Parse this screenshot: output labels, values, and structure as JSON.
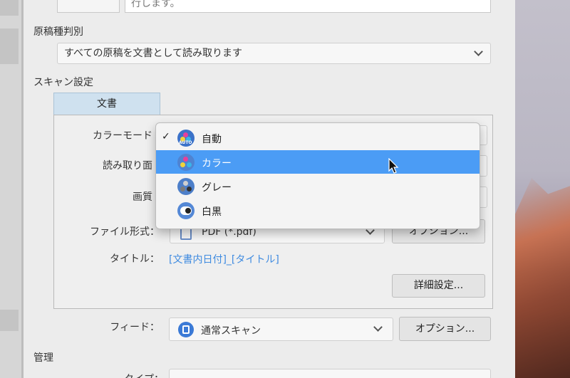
{
  "top": {
    "field_text": "行します。"
  },
  "manuscript": {
    "label": "原稿種判別",
    "value": "すべての原稿を文書として読み取ります"
  },
  "scan_settings": {
    "label": "スキャン設定",
    "tab_label": "文書",
    "color_mode_label": "カラーモード",
    "read_side_label": "読み取り面",
    "quality_label": "画質",
    "file_format_label": "ファイル形式：",
    "file_format_value": "PDF (*.pdf)",
    "options_label": "オプション...",
    "title_label": "タイトル：",
    "title_value": "[文書内日付]_[タイトル]",
    "detail_settings_label": "詳細設定..."
  },
  "color_menu": {
    "items": [
      {
        "label": "自動",
        "icon": "auto-color-icon",
        "checked": true,
        "selected": false
      },
      {
        "label": "カラー",
        "icon": "color-icon",
        "checked": false,
        "selected": true
      },
      {
        "label": "グレー",
        "icon": "gray-icon",
        "checked": false,
        "selected": false
      },
      {
        "label": "白黒",
        "icon": "black-white-icon",
        "checked": false,
        "selected": false
      }
    ],
    "check_mark": "✓",
    "auto_badge": "AUTO"
  },
  "feed": {
    "label": "フィード：",
    "value": "通常スキャン",
    "options_label": "オプション..."
  },
  "management": {
    "label": "管理",
    "type_label": "タイプ："
  },
  "colors": {
    "highlight": "#4b9cf5",
    "link": "#3f8be0",
    "tab": "#cfe1ef"
  }
}
